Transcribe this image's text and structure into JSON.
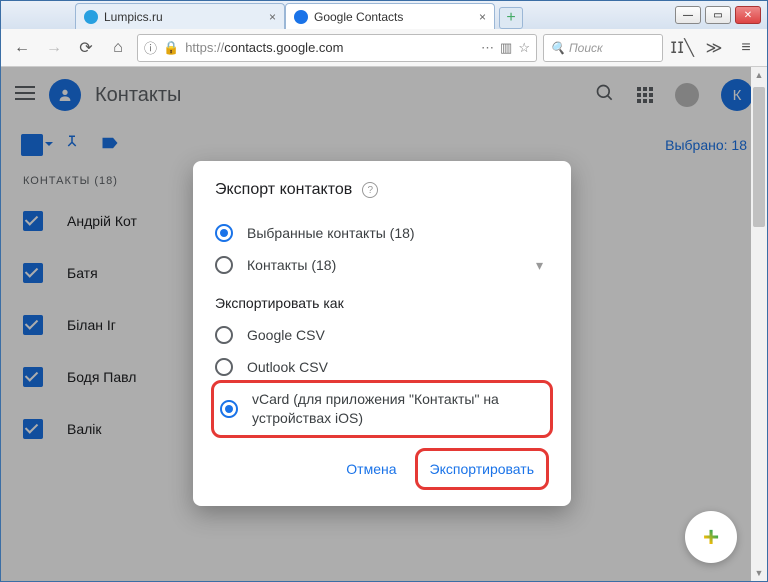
{
  "browser": {
    "tabs": [
      {
        "label": "Lumpics.ru",
        "favicon": "L",
        "active": false
      },
      {
        "label": "Google Contacts",
        "favicon": "G",
        "active": true
      }
    ],
    "url_prefix": "https://",
    "url_host": "contacts.google.com",
    "search_placeholder": "Поиск"
  },
  "app": {
    "title": "Контакты",
    "user_initial": "К",
    "selected_text": "Выбрано: 18",
    "section_label": "КОНТАКТЫ (18)",
    "contacts": [
      {
        "name": "Андрій Кот"
      },
      {
        "name": "Батя"
      },
      {
        "name": "Білан Іг"
      },
      {
        "name": "Бодя Павл"
      },
      {
        "name": "Валік"
      }
    ]
  },
  "dialog": {
    "title": "Экспорт контактов",
    "scope": {
      "selected": "Выбранные контакты (18)",
      "all": "Контакты (18)"
    },
    "export_as_label": "Экспортировать как",
    "formats": {
      "google": "Google CSV",
      "outlook": "Outlook CSV",
      "vcard": "vCard (для приложения \"Контакты\" на устройствах iOS)"
    },
    "cancel": "Отмена",
    "export": "Экспортировать"
  }
}
